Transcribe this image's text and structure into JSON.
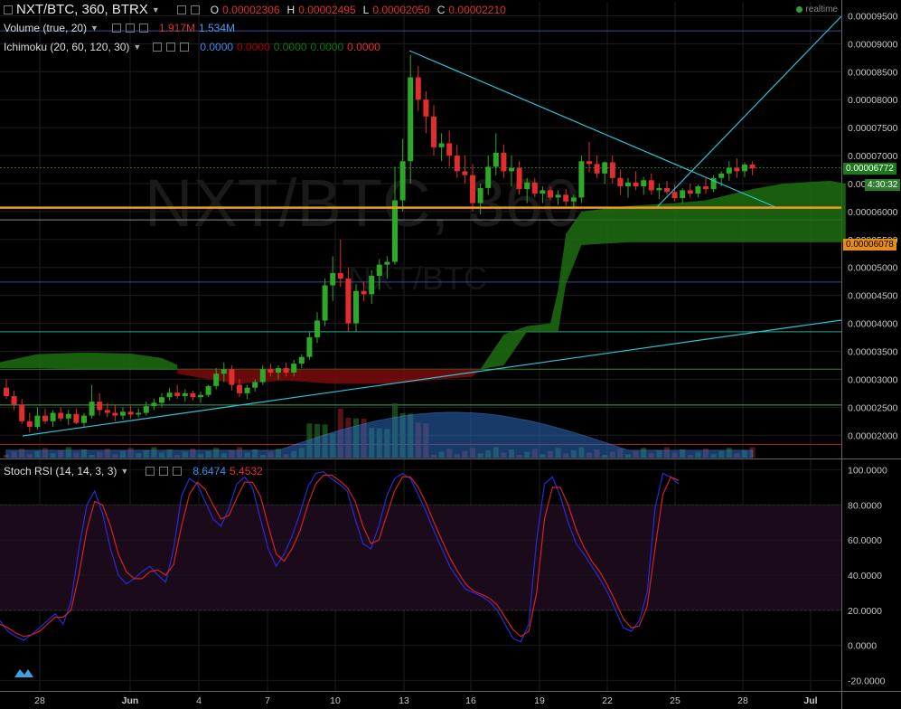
{
  "header": {
    "symbol": "NXT/BTC, 360, BTRX",
    "o_label": "O",
    "o_value": "0.00002306",
    "h_label": "H",
    "h_value": "0.00002495",
    "l_label": "L",
    "l_value": "0.00002050",
    "c_label": "C",
    "c_value": "0.00002210",
    "realtime": "realtime"
  },
  "volume_legend": {
    "label": "Volume (true, 20)",
    "v1": "1.917M",
    "v2": "1.534M"
  },
  "ichimoku_legend": {
    "label": "Ichimoku (20, 60, 120, 30)",
    "v1": "0.0000",
    "v2": "0.0000",
    "v3": "0.0000",
    "v4": "0.0000",
    "v5": "0.0000"
  },
  "stoch_legend": {
    "label": "Stoch RSI (14, 14, 3, 3)",
    "k": "8.6474",
    "d": "5.4532"
  },
  "watermark": {
    "big": "NXT/BTC, 360",
    "small": "NXT/BTC"
  },
  "price_tags": {
    "last": "0.00006772",
    "countdown": "4:30:32",
    "line": "0.00006078"
  },
  "colors": {
    "up": "#2ea829",
    "down": "#e12d2d",
    "cloud_green": "#1d6d12",
    "cloud_red": "#7a0c0c",
    "trend": "#2bc4d6",
    "orange": "#f09a1f",
    "stoch_k": "#2a2ad8",
    "stoch_d": "#d42222",
    "stoch_band": "#1a0a1a"
  },
  "chart_data": [
    {
      "type": "candlestick",
      "x_ticks": [
        "28",
        "Jun",
        "4",
        "7",
        "10",
        "13",
        "16",
        "19",
        "22",
        "25",
        "28",
        "Jul"
      ],
      "y_ticks": [
        "0.00009500",
        "0.00009000",
        "0.00008500",
        "0.00008000",
        "0.00007500",
        "0.00007000",
        "0.00006500",
        "0.00006000",
        "0.00005500",
        "0.00005000",
        "0.00004500",
        "0.00004000",
        "0.00003500",
        "0.00003000",
        "0.00002500",
        "0.00002000"
      ],
      "ylim": [
        1.6e-05,
        9.75e-05
      ],
      "candles": [
        {
          "o": 2.85e-05,
          "h": 3e-05,
          "l": 2.65e-05,
          "c": 2.7e-05
        },
        {
          "o": 2.7e-05,
          "h": 2.8e-05,
          "l": 2.45e-05,
          "c": 2.55e-05
        },
        {
          "o": 2.55e-05,
          "h": 2.65e-05,
          "l": 2.2e-05,
          "c": 2.25e-05
        },
        {
          "o": 2.25e-05,
          "h": 2.4e-05,
          "l": 2.05e-05,
          "c": 2.15e-05
        },
        {
          "o": 2.15e-05,
          "h": 2.5e-05,
          "l": 2.1e-05,
          "c": 2.35e-05
        },
        {
          "o": 2.35e-05,
          "h": 2.48e-05,
          "l": 2.2e-05,
          "c": 2.25e-05
        },
        {
          "o": 2.25e-05,
          "h": 2.45e-05,
          "l": 2.15e-05,
          "c": 2.4e-05
        },
        {
          "o": 2.4e-05,
          "h": 2.5e-05,
          "l": 2.25e-05,
          "c": 2.3e-05
        },
        {
          "o": 2.3e-05,
          "h": 2.45e-05,
          "l": 2.18e-05,
          "c": 2.38e-05
        },
        {
          "o": 2.38e-05,
          "h": 2.48e-05,
          "l": 2.2e-05,
          "c": 2.22e-05
        },
        {
          "o": 2.22e-05,
          "h": 2.4e-05,
          "l": 2.15e-05,
          "c": 2.35e-05
        },
        {
          "o": 2.35e-05,
          "h": 2.9e-05,
          "l": 2.3e-05,
          "c": 2.6e-05
        },
        {
          "o": 2.6e-05,
          "h": 2.75e-05,
          "l": 2.35e-05,
          "c": 2.45e-05
        },
        {
          "o": 2.45e-05,
          "h": 2.58e-05,
          "l": 2.32e-05,
          "c": 2.4e-05
        },
        {
          "o": 2.4e-05,
          "h": 2.55e-05,
          "l": 2.25e-05,
          "c": 2.35e-05
        },
        {
          "o": 2.35e-05,
          "h": 2.5e-05,
          "l": 2.28e-05,
          "c": 2.42e-05
        },
        {
          "o": 2.42e-05,
          "h": 2.52e-05,
          "l": 2.3e-05,
          "c": 2.37e-05
        },
        {
          "o": 2.37e-05,
          "h": 2.48e-05,
          "l": 2.32e-05,
          "c": 2.4e-05
        },
        {
          "o": 2.4e-05,
          "h": 2.6e-05,
          "l": 2.35e-05,
          "c": 2.52e-05
        },
        {
          "o": 2.52e-05,
          "h": 2.65e-05,
          "l": 2.45e-05,
          "c": 2.58e-05
        },
        {
          "o": 2.58e-05,
          "h": 2.75e-05,
          "l": 2.5e-05,
          "c": 2.68e-05
        },
        {
          "o": 2.68e-05,
          "h": 2.85e-05,
          "l": 2.62e-05,
          "c": 2.76e-05
        },
        {
          "o": 2.76e-05,
          "h": 2.9e-05,
          "l": 2.65e-05,
          "c": 2.7e-05
        },
        {
          "o": 2.7e-05,
          "h": 2.82e-05,
          "l": 2.6e-05,
          "c": 2.75e-05
        },
        {
          "o": 2.75e-05,
          "h": 2.8e-05,
          "l": 2.62e-05,
          "c": 2.68e-05
        },
        {
          "o": 2.68e-05,
          "h": 2.78e-05,
          "l": 2.58e-05,
          "c": 2.72e-05
        },
        {
          "o": 2.72e-05,
          "h": 2.9e-05,
          "l": 2.68e-05,
          "c": 2.88e-05
        },
        {
          "o": 2.88e-05,
          "h": 3.2e-05,
          "l": 2.82e-05,
          "c": 3.1e-05
        },
        {
          "o": 3.1e-05,
          "h": 3.3e-05,
          "l": 2.95e-05,
          "c": 3.18e-05
        },
        {
          "o": 3.18e-05,
          "h": 3.25e-05,
          "l": 2.8e-05,
          "c": 2.9e-05
        },
        {
          "o": 2.9e-05,
          "h": 3e-05,
          "l": 2.68e-05,
          "c": 2.75e-05
        },
        {
          "o": 2.75e-05,
          "h": 2.9e-05,
          "l": 2.65e-05,
          "c": 2.85e-05
        },
        {
          "o": 2.85e-05,
          "h": 3e-05,
          "l": 2.78e-05,
          "c": 2.95e-05
        },
        {
          "o": 2.95e-05,
          "h": 3.25e-05,
          "l": 2.9e-05,
          "c": 3.18e-05
        },
        {
          "o": 3.18e-05,
          "h": 3.28e-05,
          "l": 3.05e-05,
          "c": 3.12e-05
        },
        {
          "o": 3.12e-05,
          "h": 3.25e-05,
          "l": 3e-05,
          "c": 3.2e-05
        },
        {
          "o": 3.2e-05,
          "h": 3.3e-05,
          "l": 3.05e-05,
          "c": 3.12e-05
        },
        {
          "o": 3.12e-05,
          "h": 3.35e-05,
          "l": 3.05e-05,
          "c": 3.28e-05
        },
        {
          "o": 3.28e-05,
          "h": 3.45e-05,
          "l": 3.2e-05,
          "c": 3.4e-05
        },
        {
          "o": 3.4e-05,
          "h": 3.85e-05,
          "l": 3.35e-05,
          "c": 3.75e-05
        },
        {
          "o": 3.75e-05,
          "h": 4.2e-05,
          "l": 3.65e-05,
          "c": 4.05e-05
        },
        {
          "o": 4.05e-05,
          "h": 4.8e-05,
          "l": 3.95e-05,
          "c": 4.68e-05
        },
        {
          "o": 4.68e-05,
          "h": 5.2e-05,
          "l": 4.4e-05,
          "c": 4.9e-05
        },
        {
          "o": 4.9e-05,
          "h": 5.5e-05,
          "l": 4.65e-05,
          "c": 4.8e-05
        },
        {
          "o": 4.8e-05,
          "h": 5e-05,
          "l": 3.85e-05,
          "c": 4e-05
        },
        {
          "o": 4e-05,
          "h": 4.7e-05,
          "l": 3.85e-05,
          "c": 4.58e-05
        },
        {
          "o": 4.58e-05,
          "h": 4.75e-05,
          "l": 4.4e-05,
          "c": 4.52e-05
        },
        {
          "o": 4.52e-05,
          "h": 4.95e-05,
          "l": 4.35e-05,
          "c": 4.85e-05
        },
        {
          "o": 4.85e-05,
          "h": 5.15e-05,
          "l": 4.6e-05,
          "c": 5.05e-05
        },
        {
          "o": 5.05e-05,
          "h": 5.2e-05,
          "l": 4.8e-05,
          "c": 5.1e-05
        },
        {
          "o": 5.1e-05,
          "h": 6.8e-05,
          "l": 5.05e-05,
          "c": 6.2e-05
        },
        {
          "o": 6.2e-05,
          "h": 7.3e-05,
          "l": 6e-05,
          "c": 6.9e-05
        },
        {
          "o": 6.9e-05,
          "h": 8.8e-05,
          "l": 6.5e-05,
          "c": 8.4e-05
        },
        {
          "o": 8.4e-05,
          "h": 8.6e-05,
          "l": 7.8e-05,
          "c": 8e-05
        },
        {
          "o": 8e-05,
          "h": 8.15e-05,
          "l": 7.4e-05,
          "c": 7.7e-05
        },
        {
          "o": 7.7e-05,
          "h": 7.9e-05,
          "l": 7e-05,
          "c": 7.15e-05
        },
        {
          "o": 7.15e-05,
          "h": 7.4e-05,
          "l": 6.9e-05,
          "c": 7.22e-05
        },
        {
          "o": 7.22e-05,
          "h": 7.45e-05,
          "l": 6.8e-05,
          "c": 7e-05
        },
        {
          "o": 7e-05,
          "h": 7.2e-05,
          "l": 6.6e-05,
          "c": 6.72e-05
        },
        {
          "o": 6.72e-05,
          "h": 7e-05,
          "l": 6.5e-05,
          "c": 6.65e-05
        },
        {
          "o": 6.65e-05,
          "h": 6.85e-05,
          "l": 6e-05,
          "c": 6.15e-05
        },
        {
          "o": 6.15e-05,
          "h": 6.5e-05,
          "l": 5.95e-05,
          "c": 6.42e-05
        },
        {
          "o": 6.42e-05,
          "h": 7e-05,
          "l": 6.3e-05,
          "c": 6.8e-05
        },
        {
          "o": 6.8e-05,
          "h": 7.4e-05,
          "l": 6.65e-05,
          "c": 7.05e-05
        },
        {
          "o": 7.05e-05,
          "h": 7.2e-05,
          "l": 6.6e-05,
          "c": 6.72e-05
        },
        {
          "o": 6.72e-05,
          "h": 7e-05,
          "l": 6.45e-05,
          "c": 6.78e-05
        },
        {
          "o": 6.78e-05,
          "h": 6.9e-05,
          "l": 6.3e-05,
          "c": 6.4e-05
        },
        {
          "o": 6.4e-05,
          "h": 6.6e-05,
          "l": 6.15e-05,
          "c": 6.52e-05
        },
        {
          "o": 6.52e-05,
          "h": 6.6e-05,
          "l": 6.25e-05,
          "c": 6.32e-05
        },
        {
          "o": 6.32e-05,
          "h": 6.45e-05,
          "l": 6.15e-05,
          "c": 6.38e-05
        },
        {
          "o": 6.38e-05,
          "h": 6.45e-05,
          "l": 6.2e-05,
          "c": 6.25e-05
        },
        {
          "o": 6.25e-05,
          "h": 6.38e-05,
          "l": 6.12e-05,
          "c": 6.3e-05
        },
        {
          "o": 6.3e-05,
          "h": 6.4e-05,
          "l": 6.1e-05,
          "c": 6.18e-05
        },
        {
          "o": 6.18e-05,
          "h": 6.3e-05,
          "l": 6.05e-05,
          "c": 6.25e-05
        },
        {
          "o": 6.25e-05,
          "h": 7e-05,
          "l": 6.15e-05,
          "c": 6.9e-05
        },
        {
          "o": 6.9e-05,
          "h": 7.25e-05,
          "l": 6.7e-05,
          "c": 6.85e-05
        },
        {
          "o": 6.85e-05,
          "h": 7e-05,
          "l": 6.6e-05,
          "c": 6.68e-05
        },
        {
          "o": 6.68e-05,
          "h": 6.9e-05,
          "l": 6.5e-05,
          "c": 6.88e-05
        },
        {
          "o": 6.88e-05,
          "h": 7e-05,
          "l": 6.5e-05,
          "c": 6.6e-05
        },
        {
          "o": 6.6e-05,
          "h": 6.75e-05,
          "l": 6.3e-05,
          "c": 6.45e-05
        },
        {
          "o": 6.45e-05,
          "h": 6.6e-05,
          "l": 6.25e-05,
          "c": 6.52e-05
        },
        {
          "o": 6.52e-05,
          "h": 6.72e-05,
          "l": 6.38e-05,
          "c": 6.45e-05
        },
        {
          "o": 6.45e-05,
          "h": 6.62e-05,
          "l": 6.3e-05,
          "c": 6.56e-05
        },
        {
          "o": 6.56e-05,
          "h": 6.68e-05,
          "l": 6.3e-05,
          "c": 6.38e-05
        },
        {
          "o": 6.38e-05,
          "h": 6.5e-05,
          "l": 6.22e-05,
          "c": 6.42e-05
        },
        {
          "o": 6.42e-05,
          "h": 6.55e-05,
          "l": 6.3e-05,
          "c": 6.35e-05
        },
        {
          "o": 6.35e-05,
          "h": 6.48e-05,
          "l": 6.18e-05,
          "c": 6.24e-05
        },
        {
          "o": 6.24e-05,
          "h": 6.42e-05,
          "l": 6.15e-05,
          "c": 6.38e-05
        },
        {
          "o": 6.38e-05,
          "h": 6.5e-05,
          "l": 6.25e-05,
          "c": 6.32e-05
        },
        {
          "o": 6.32e-05,
          "h": 6.48e-05,
          "l": 6.25e-05,
          "c": 6.45e-05
        },
        {
          "o": 6.45e-05,
          "h": 6.6e-05,
          "l": 6.32e-05,
          "c": 6.4e-05
        },
        {
          "o": 6.4e-05,
          "h": 6.65e-05,
          "l": 6.35e-05,
          "c": 6.6e-05
        },
        {
          "o": 6.6e-05,
          "h": 6.72e-05,
          "l": 6.45e-05,
          "c": 6.68e-05
        },
        {
          "o": 6.68e-05,
          "h": 6.9e-05,
          "l": 6.55e-05,
          "c": 6.78e-05
        },
        {
          "o": 6.78e-05,
          "h": 6.95e-05,
          "l": 6.6e-05,
          "c": 6.72e-05
        },
        {
          "o": 6.72e-05,
          "h": 6.88e-05,
          "l": 6.62e-05,
          "c": 6.84e-05
        },
        {
          "o": 6.84e-05,
          "h": 6.9e-05,
          "l": 6.65e-05,
          "c": 6.77e-05
        }
      ]
    },
    {
      "type": "line",
      "title": "Stoch RSI (14, 14, 3, 3)",
      "y_ticks": [
        "100.0000",
        "80.0000",
        "60.0000",
        "40.0000",
        "20.0000",
        "0.0000",
        "-20.0000"
      ],
      "ylim": [
        -26,
        106
      ],
      "series": [
        {
          "name": "K",
          "values": [
            14,
            8,
            5,
            3,
            6,
            10,
            14,
            18,
            12,
            25,
            55,
            80,
            88,
            75,
            55,
            40,
            35,
            38,
            42,
            45,
            40,
            36,
            55,
            85,
            95,
            92,
            82,
            72,
            68,
            78,
            92,
            96,
            90,
            72,
            55,
            45,
            52,
            62,
            75,
            90,
            98,
            99,
            95,
            92,
            88,
            72,
            58,
            55,
            68,
            85,
            95,
            98,
            95,
            86,
            76,
            65,
            55,
            45,
            38,
            32,
            30,
            28,
            25,
            20,
            12,
            4,
            2,
            12,
            60,
            92,
            96,
            85,
            70,
            58,
            52,
            45,
            38,
            30,
            20,
            10,
            8,
            14,
            30,
            78,
            98,
            96,
            92
          ]
        },
        {
          "name": "D",
          "values": [
            12,
            10,
            7,
            5,
            6,
            8,
            12,
            16,
            16,
            20,
            40,
            66,
            82,
            80,
            68,
            52,
            42,
            38,
            38,
            42,
            43,
            40,
            46,
            68,
            86,
            93,
            89,
            80,
            72,
            74,
            84,
            93,
            93,
            85,
            68,
            52,
            48,
            55,
            65,
            80,
            92,
            97,
            97,
            94,
            90,
            82,
            68,
            58,
            60,
            74,
            88,
            96,
            96,
            90,
            81,
            70,
            60,
            50,
            42,
            35,
            31,
            29,
            27,
            23,
            16,
            9,
            5,
            8,
            30,
            72,
            90,
            90,
            80,
            66,
            56,
            48,
            42,
            34,
            25,
            15,
            10,
            11,
            22,
            55,
            86,
            96,
            94
          ]
        }
      ]
    }
  ]
}
